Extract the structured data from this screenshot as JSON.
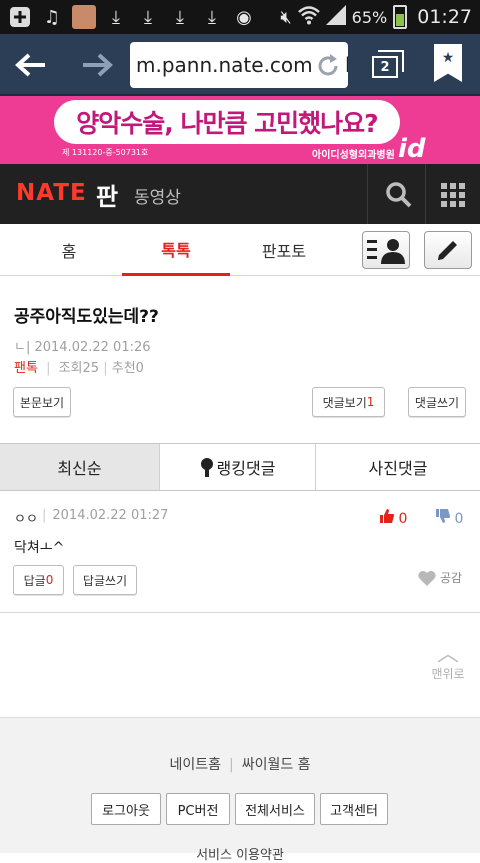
{
  "status_bar": {
    "battery": "65%",
    "time": "01:27"
  },
  "browser": {
    "url": "m.pann.nate.com/talk",
    "tab_count": "2"
  },
  "ad": {
    "headline": "양악수술, 나만큼 고민했나요?",
    "fine_print": "제 131120-중-50731호",
    "brand": "아이디성형외과병원",
    "logo": "id"
  },
  "header": {
    "logo": "NATE",
    "title": "판",
    "video_link": "동영상"
  },
  "tabs": [
    {
      "label": "홈"
    },
    {
      "label": "톡톡"
    },
    {
      "label": "판포토"
    }
  ],
  "post": {
    "title": "공주아직도있는데??",
    "author_mark": "ㄴ|",
    "date": "2014.02.22 01:26",
    "category": "팬톡",
    "views": "조회25",
    "recommends": "추천0",
    "view_body_btn": "본문보기",
    "view_comments_label": "댓글보기",
    "view_comments_count": "1",
    "write_comment_btn": "댓글쓰기"
  },
  "comment_tabs": [
    {
      "label": "최신순"
    },
    {
      "label": "랭킹댓글"
    },
    {
      "label": "사진댓글"
    }
  ],
  "comment": {
    "author": "ㅇㅇ",
    "date": "2014.02.22 01:27",
    "likes": "0",
    "dislikes": "0",
    "body": "닥쳐ㅗ^",
    "reply_label": "답글",
    "reply_count": "0",
    "write_reply_btn": "답글쓰기",
    "empathy_label": "공감"
  },
  "to_top": "맨위로",
  "footer": {
    "links": [
      "네이트홈",
      "싸이월드 홈"
    ],
    "buttons": [
      "로그아웃",
      "PC버전",
      "전체서비스",
      "고객센터"
    ],
    "more": "서비스 이용약관"
  }
}
